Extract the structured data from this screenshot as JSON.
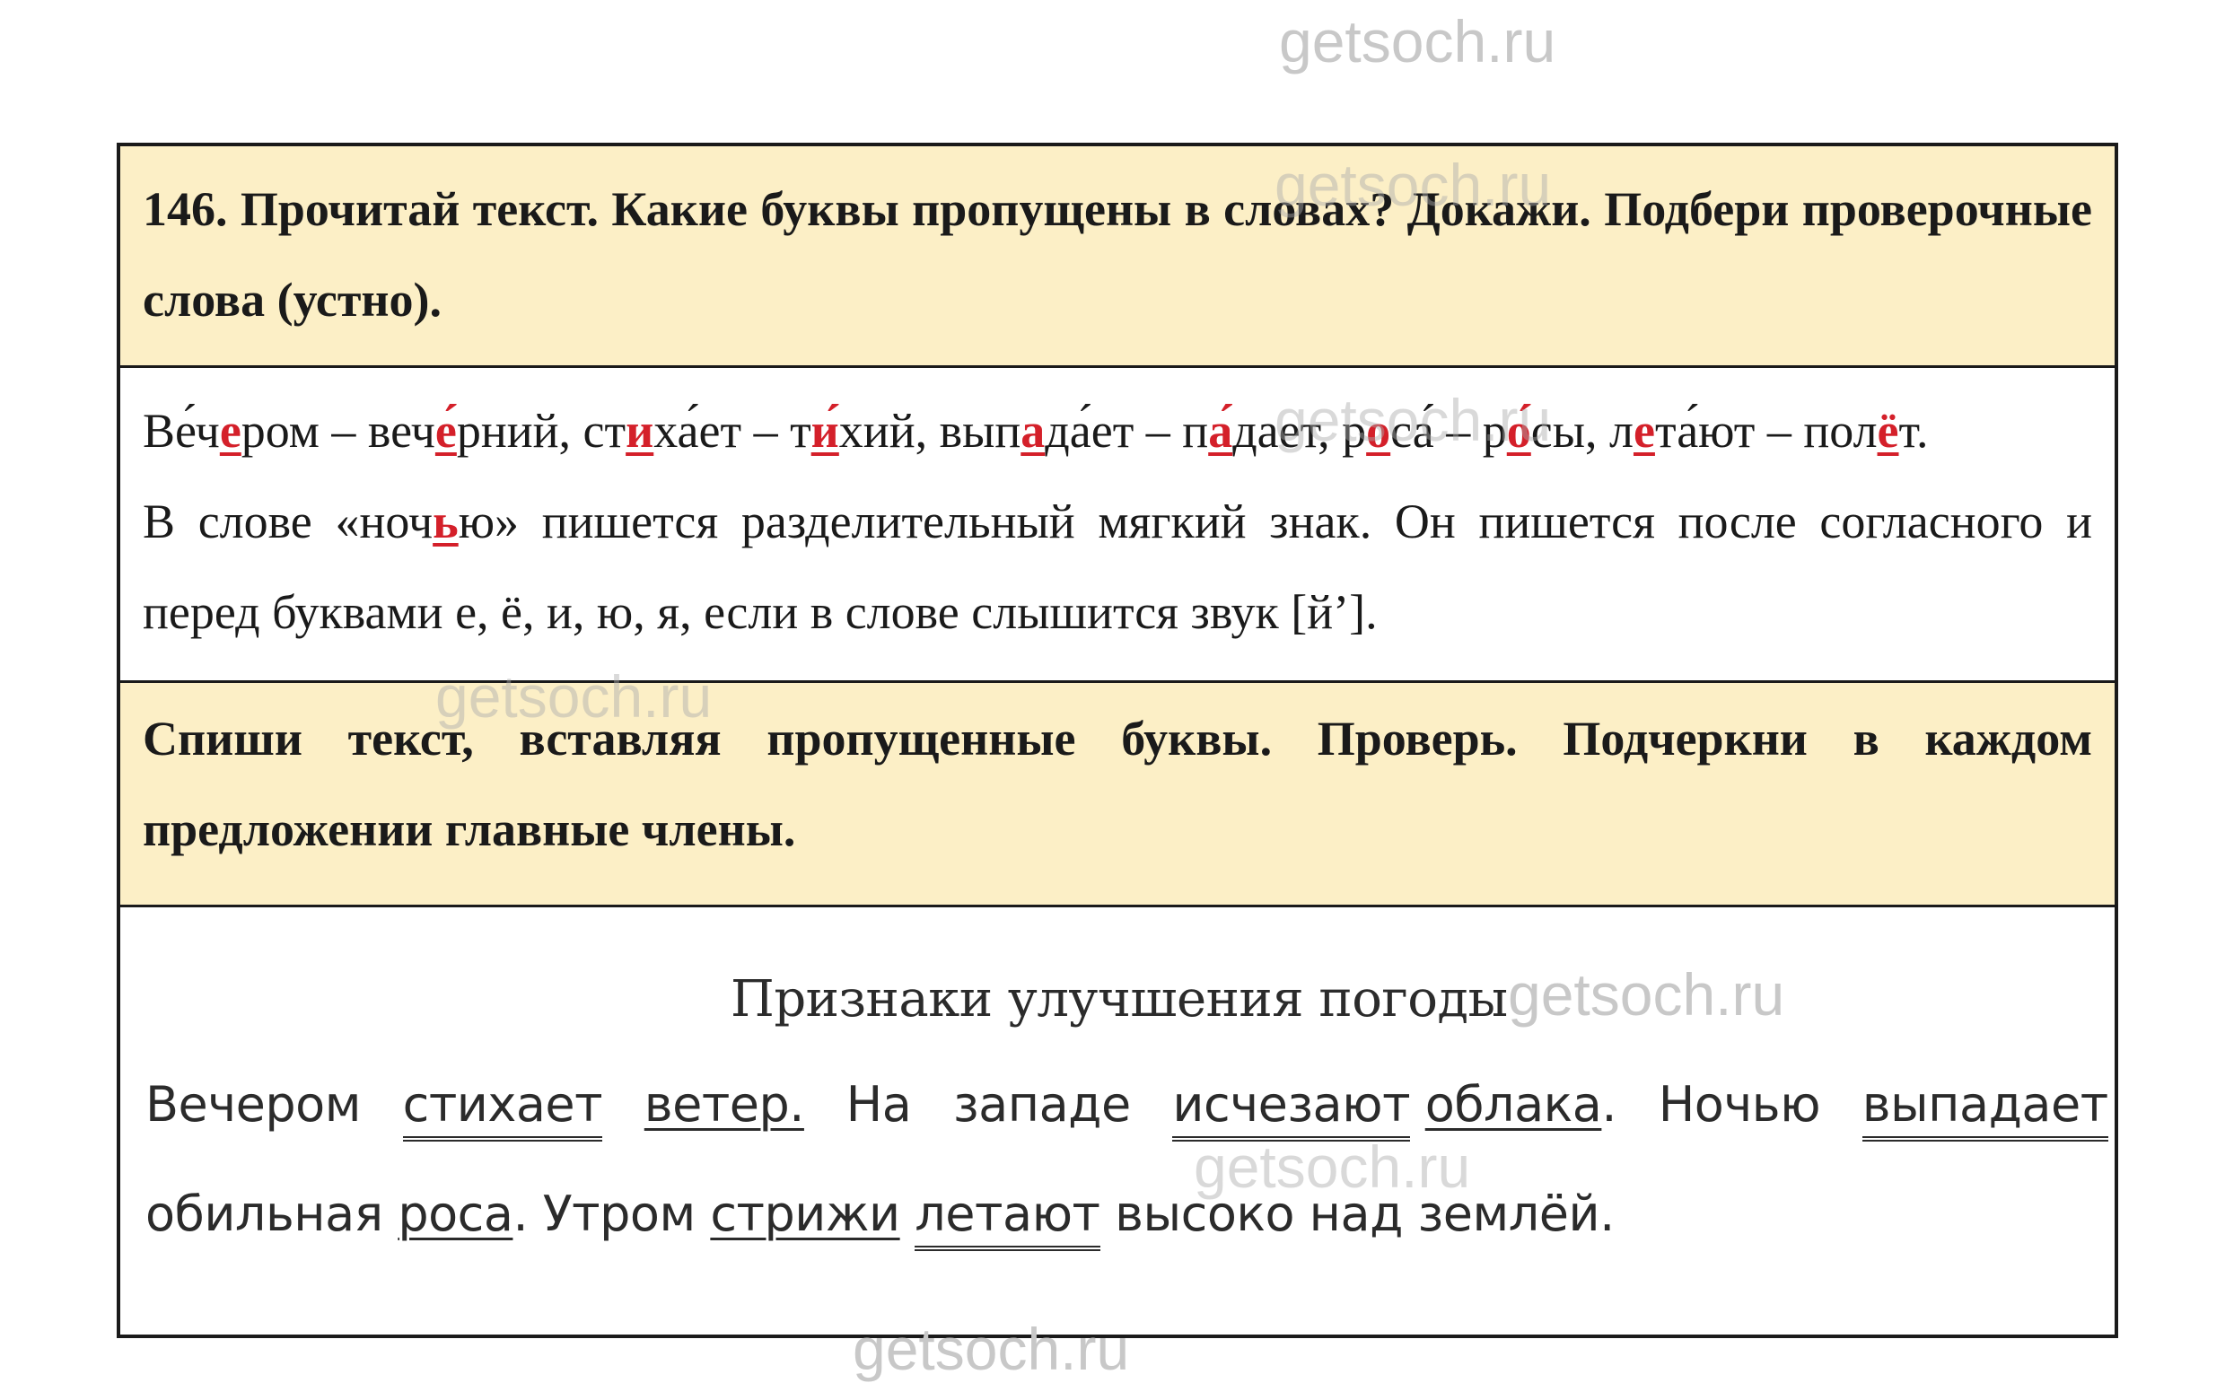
{
  "watermark": "getsoch.ru",
  "task": {
    "number": "146.",
    "prompt": "Прочитай текст. Какие буквы пропущены в словах? Докажи. Подбери проверочные слова (устно)."
  },
  "answer1": {
    "pairs": [
      {
        "pre": "Ве́ч",
        "mark": "е",
        "post": "ром – веч"
      },
      {
        "pre": "",
        "mark": "е́",
        "post": "рний, ст"
      },
      {
        "pre": "",
        "mark": "и",
        "post": "ха́ет – т"
      },
      {
        "pre": "",
        "mark": "и́",
        "post": "хий, вып"
      },
      {
        "pre": "",
        "mark": "а",
        "post": "да́ет – п"
      },
      {
        "pre": "",
        "mark": "а́",
        "post": "дает, р"
      },
      {
        "pre": "",
        "mark": "о",
        "post": "са́ – р"
      },
      {
        "pre": "",
        "mark": "о́",
        "post": "сы, л"
      },
      {
        "pre": "",
        "mark": "е",
        "post": "та́ют – пол"
      },
      {
        "pre": "",
        "mark": "ё",
        "post": "т."
      }
    ],
    "soft_sign_pre": "В слове «ноч",
    "soft_sign_mark": "ь",
    "soft_sign_post": "ю» пишется разделительный мягкий знак. Он пишется после согласного и перед буквами е, ё, и, ю, я, если в слове слышится звук [й’]."
  },
  "task2": {
    "prompt": "Спиши текст, вставляя пропущенные буквы. Проверь. Подчеркни в каждом предложении главные члены."
  },
  "answer2": {
    "title": "Признаки улучшения погоды",
    "w1": "Вечером",
    "w2": "стихает",
    "w3": "ветер.",
    "w4": "На западе",
    "w5": "исчезают",
    "w6": "облака",
    "w7": ". Ночью",
    "w8": "выпадает",
    "w9": "обильная",
    "w10": "роса",
    "w11": ". Утром",
    "w12": "стрижи",
    "w13": "летают",
    "w14": "высоко над землёй."
  }
}
